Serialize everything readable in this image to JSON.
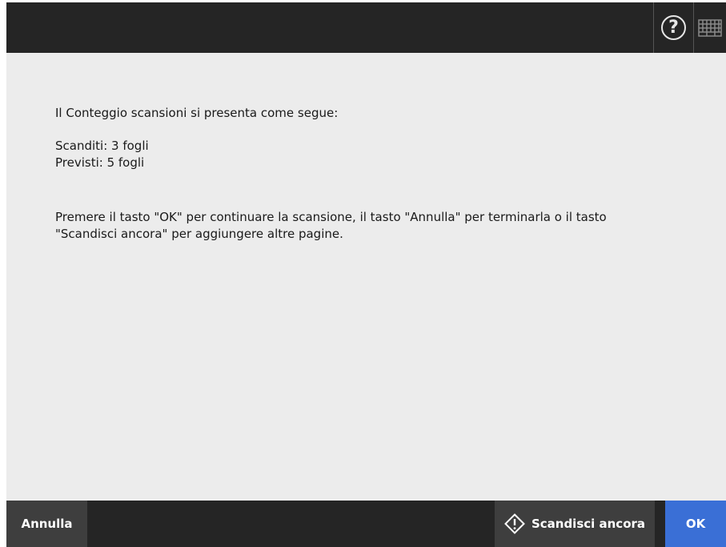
{
  "header": {
    "help_icon_glyph": "?"
  },
  "message": {
    "line1": "Il Conteggio scansioni si presenta come segue:",
    "scanned": "Scanditi: 3 fogli",
    "expected": "Previsti: 5 fogli",
    "instructions_line1": "Premere il tasto \"OK\" per continuare la scansione, il tasto \"Annulla\" per terminarla o il tasto",
    "instructions_line2": "\"Scandisci ancora\" per aggiungere altre pagine."
  },
  "footer": {
    "cancel_label": "Annulla",
    "rescan_label": "Scandisci ancora",
    "ok_label": "OK"
  },
  "colors": {
    "bar": "#252525",
    "button": "#3e3e3e",
    "ok_accent": "#3a6fd6",
    "background": "#ececec"
  }
}
